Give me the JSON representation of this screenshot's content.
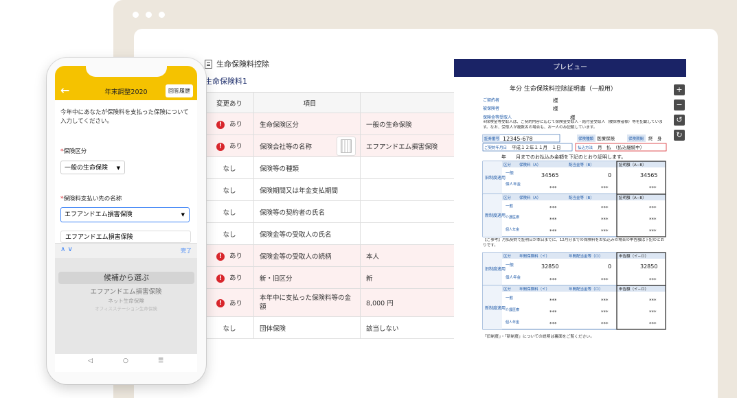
{
  "main": {
    "header": "生命保険料控除",
    "section": "生命保険料1",
    "columns": [
      "変更あり",
      "項目",
      ""
    ],
    "rows": [
      {
        "change": "あり",
        "flag": true,
        "item": "生命保険区分",
        "value": "一般の生命保険"
      },
      {
        "change": "あり",
        "flag": true,
        "item": "保険会社等の名称",
        "value": "エフアンドエム損害保険"
      },
      {
        "change": "なし",
        "flag": false,
        "item": "保険等の種類",
        "value": ""
      },
      {
        "change": "なし",
        "flag": false,
        "item": "保険期間又は年金支払期間",
        "value": ""
      },
      {
        "change": "なし",
        "flag": false,
        "item": "保険等の契約者の氏名",
        "value": ""
      },
      {
        "change": "なし",
        "flag": false,
        "item": "保険金等の受取人の氏名",
        "value": ""
      },
      {
        "change": "あり",
        "flag": true,
        "item": "保険金等の受取人の続柄",
        "value": "本人"
      },
      {
        "change": "あり",
        "flag": true,
        "item": "新・旧区分",
        "value": "新"
      },
      {
        "change": "あり",
        "flag": true,
        "item": "本年中に支払った保険料等の金額",
        "value": "8,000 円"
      },
      {
        "change": "なし",
        "flag": false,
        "item": "団体保険",
        "value": "該当しない"
      }
    ]
  },
  "preview": {
    "bar": "プレビュー",
    "doc_title": "年分 生命保険料控除証明書（一般用）",
    "contractor_lbl": "ご契約者",
    "insured_lbl": "被保険者",
    "sama": "様",
    "recipient_lbl": "保険金等受取人",
    "note": "※保険金等受取人は、ご契約内容に応じて保険金受取人・給付金受取人（被保険者様）等を記載しています。なお、受取人が複数名の場合も、お一人のみ記載しています。",
    "policy_no_lbl": "証券番号",
    "policy_no": "12345-678",
    "type_lbl": "保険種類",
    "type_val": "医療保険",
    "period_lbl": "保険期間",
    "period_val": "終　身",
    "date_lbl": "ご契約年月日",
    "date_val": "平成１２年１１月　１日",
    "pay_lbl": "払込方法",
    "pay_val": "月　払　（払込継続中）",
    "certify": "年　　月までのお払込み金額を下記のとおり証明します。",
    "old_lbl": "旧制度適用",
    "new_lbl": "新制度適用",
    "hdr_kubun": "区分",
    "hdr_prem": "保険料（A）",
    "hdr_div": "配当金等（B）",
    "hdr_cert": "証明額（A−B）",
    "cat_general": "一般",
    "cat_pension": "個人年金",
    "cat_care": "介護医療",
    "old_general": [
      "34565",
      "0",
      "34565"
    ],
    "masked": "***",
    "ref_note": "【ご参考】月払契約で証明日が本日までに、12月分までの保険料をお払込みの場合の申告額は下記のとおりです。",
    "hdr_prem2": "年間保険料（イ）",
    "hdr_div2": "年間配当金等（ロ）",
    "hdr_decl": "申告額（イ−ロ）",
    "ref_general": [
      "32850",
      "0",
      "32850"
    ],
    "footer": "「旧制度」・「新制度」についての説明は裏面をご覧ください。",
    "en": "円"
  },
  "phone": {
    "title": "年末調整2020",
    "history_button": "回答履歴",
    "intro": "今年中にあなたが保険料を支払った保険について入力してください。",
    "field1_label": "保険区分",
    "field1_value": "一般の生命保険",
    "field2_label": "保険料支払い先の名称",
    "field2_value": "エフアンドエム損害保険",
    "suggestion": "エフアンドエム損害保険",
    "done": "完了",
    "picker_selected": "候補から選ぶ",
    "picker_options": [
      "エフアンドエム損害保険",
      "ネット生命保険",
      "オフィスステーション生命保険"
    ],
    "required_mark": "*"
  },
  "colors": {
    "accent_yellow": "#f5c200",
    "navy": "#1a2366",
    "warn_red": "#d8262c",
    "form_blue": "#1f5aa8"
  }
}
